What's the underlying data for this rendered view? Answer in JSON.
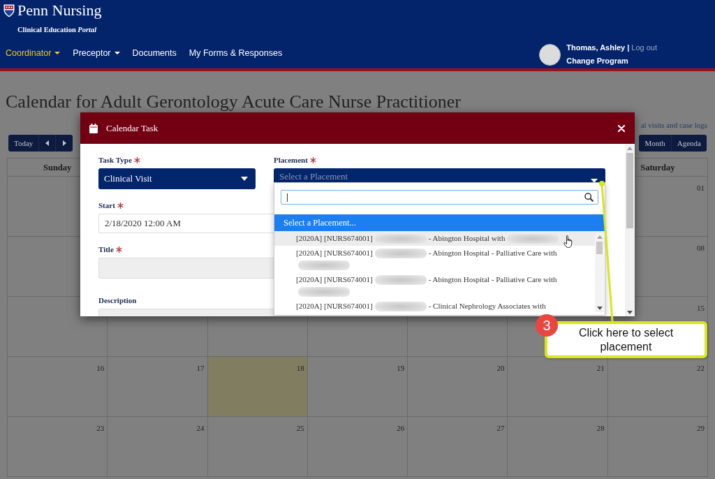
{
  "header": {
    "logo": {
      "title": "Penn Nursing",
      "subtitle": "Clinical Education *Portal*"
    },
    "nav": [
      {
        "label": "Coordinator",
        "dropdown": true,
        "selected": true
      },
      {
        "label": "Preceptor",
        "dropdown": true,
        "selected": false
      },
      {
        "label": "Documents",
        "dropdown": false,
        "selected": false
      },
      {
        "label": "My Forms & Responses",
        "dropdown": false,
        "selected": false
      }
    ],
    "user": {
      "name": "Thomas, Ashley",
      "separator": "|",
      "logout": "Log out",
      "change_program": "Change Program"
    }
  },
  "page": {
    "title": "Calendar for Adult Gerontology Acute Care Nurse Practitioner",
    "link": "al visits and case logs"
  },
  "toolbar": {
    "today": "Today",
    "views": [
      {
        "label": "Month"
      },
      {
        "label": "Agenda"
      }
    ]
  },
  "calendar": {
    "day_headers": [
      "Sunday",
      "Saturday"
    ],
    "weeks": [
      {
        "days": [
          {
            "today": false
          },
          {
            "label": "01",
            "today": false
          }
        ]
      },
      {
        "days": [
          {
            "today": false
          },
          {
            "label": "08",
            "today": false
          }
        ]
      },
      {
        "days": [
          {
            "today": false
          },
          {
            "today": false
          },
          {
            "today": false
          },
          {
            "today": false
          },
          {
            "today": false
          },
          {
            "today": false
          },
          {
            "label": "15",
            "today": false
          }
        ]
      },
      {
        "days": [
          {
            "label": "16",
            "today": false
          },
          {
            "label": "17",
            "today": false
          },
          {
            "label": "18",
            "today": true
          },
          {
            "label": "19",
            "today": false
          },
          {
            "label": "20",
            "today": false
          },
          {
            "label": "21",
            "today": false
          },
          {
            "label": "22",
            "today": false
          }
        ]
      },
      {
        "days": [
          {
            "label": "23",
            "today": false
          },
          {
            "label": "24",
            "today": false
          },
          {
            "label": "25",
            "today": false
          },
          {
            "label": "26",
            "today": false
          },
          {
            "label": "27",
            "today": false
          },
          {
            "label": "28",
            "today": false
          },
          {
            "label": "29",
            "today": false
          }
        ]
      }
    ]
  },
  "modal": {
    "title": "Calendar Task",
    "fields": [
      {
        "kind": "select",
        "label": "Task Type",
        "required": true,
        "value": "Clinical Visit",
        "open": false
      },
      {
        "kind": "select",
        "label": "Placement",
        "required": true,
        "placeholder": "Select a Placement",
        "open": true,
        "dropdown": {
          "search": {
            "focused": true
          },
          "prompt": {
            "text": "Select a Placement...",
            "selected": true
          },
          "options": [
            {
              "parts": [
                {
                  "kind": "text",
                  "text": "[2020A] [NURS674001]"
                },
                {
                  "kind": "redacted"
                },
                {
                  "kind": "text",
                  "text": "- Abington Hospital with"
                },
                {
                  "kind": "redacted"
                }
              ],
              "selected": false,
              "hovered": true
            },
            {
              "parts": [
                {
                  "kind": "text",
                  "text": "[2020A] [NURS674001]"
                },
                {
                  "kind": "redacted"
                },
                {
                  "kind": "text",
                  "text": "- Abington Hospital - Palliative Care with"
                },
                {
                  "kind": "redacted"
                }
              ],
              "selected": false,
              "hovered": false
            },
            {
              "parts": [
                {
                  "kind": "text",
                  "text": "[2020A] [NURS674001]"
                },
                {
                  "kind": "redacted"
                },
                {
                  "kind": "text",
                  "text": "- Abington Hospital - Palliative Care with"
                },
                {
                  "kind": "redacted"
                }
              ],
              "selected": false,
              "hovered": false
            },
            {
              "parts": [
                {
                  "kind": "text",
                  "text": "[2020A] [NURS674001]"
                },
                {
                  "kind": "redacted"
                },
                {
                  "kind": "text",
                  "text": "- Clinical Nephrology Associates with"
                }
              ],
              "selected": false,
              "hovered": false
            }
          ]
        }
      },
      {
        "kind": "input",
        "label": "Start",
        "required": true,
        "value": "2/18/2020 12:00 AM",
        "disabled": false
      },
      {
        "kind": "input",
        "label": "Title",
        "required": true,
        "disabled": true
      },
      {
        "kind": "textarea",
        "label": "Description",
        "required": false,
        "disabled": true
      }
    ]
  },
  "callout": {
    "step": "3",
    "text": "Click here to select placement"
  }
}
